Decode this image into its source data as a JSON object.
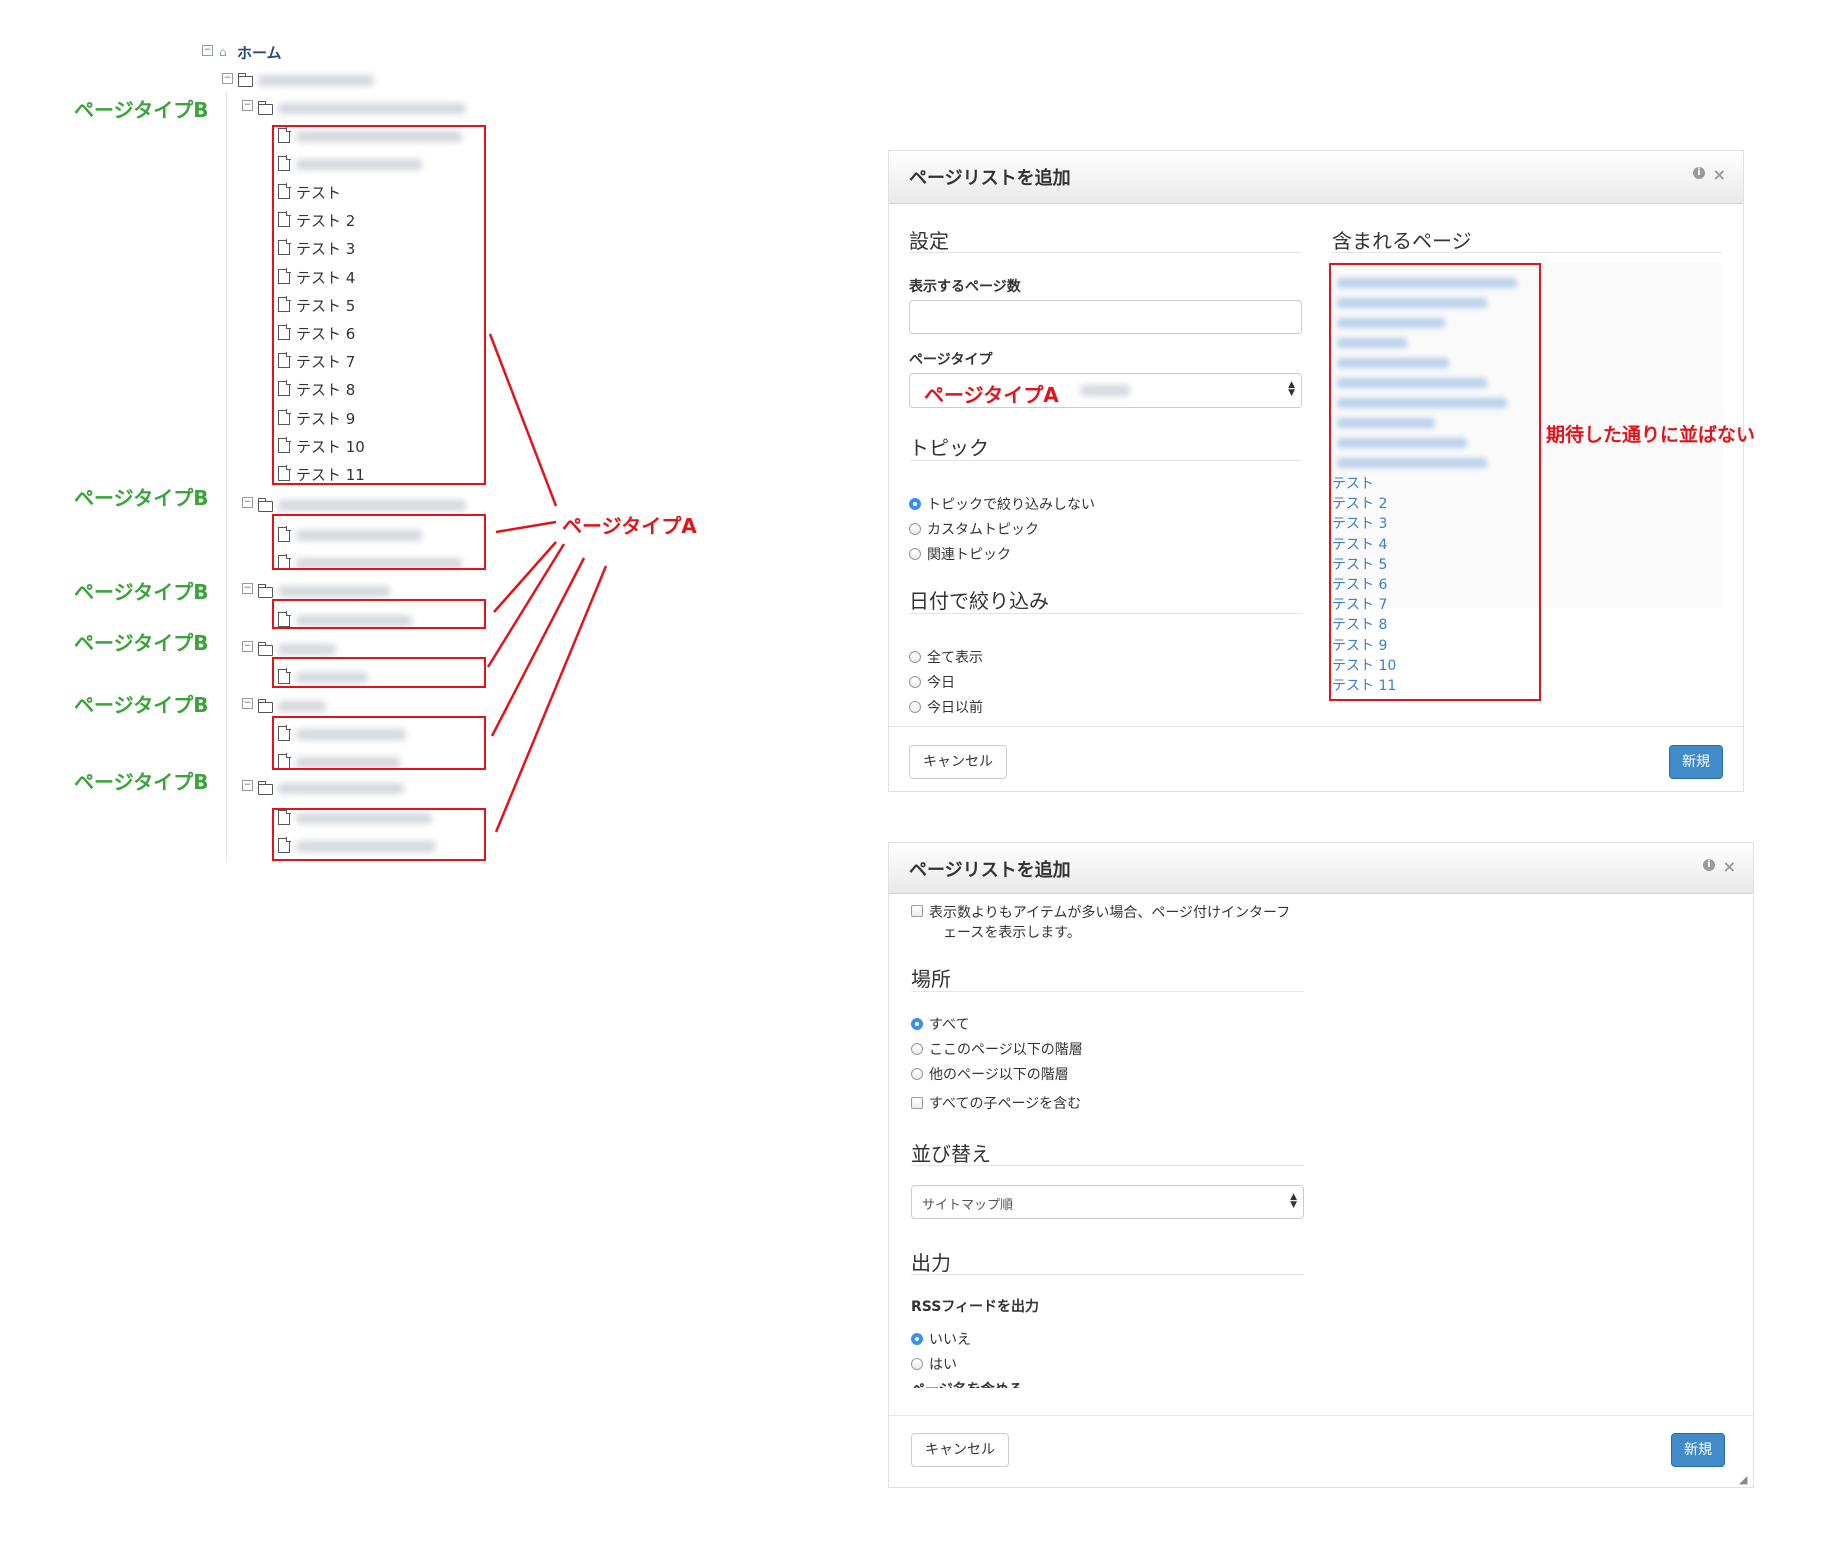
{
  "tree": {
    "home_label": "ホーム",
    "test_pages": [
      "テスト",
      "テスト 2",
      "テスト 3",
      "テスト 4",
      "テスト 5",
      "テスト 6",
      "テスト 7",
      "テスト 8",
      "テスト 9",
      "テスト 10",
      "テスト 11"
    ]
  },
  "annotations": {
    "page_type_a": "ページタイプA",
    "page_type_b": "ページタイプB",
    "not_sorted": "期待した通りに並ばない"
  },
  "dialog1": {
    "title": "ページリストを追加",
    "settings_heading": "設定",
    "count_label": "表示するページ数",
    "count_value": "",
    "page_type_label": "ページタイプ",
    "page_type_value": "ページタイプA",
    "topic_heading": "トピック",
    "topic_options": [
      "トピックで絞り込みしない",
      "カスタムトピック",
      "関連トピック"
    ],
    "date_heading": "日付で絞り込み",
    "date_options": [
      "全て表示",
      "今日",
      "今日以前"
    ],
    "included_heading": "含まれるページ",
    "included_pages": [
      "テスト",
      "テスト 2",
      "テスト 3",
      "テスト 4",
      "テスト 5",
      "テスト 6",
      "テスト 7",
      "テスト 8",
      "テスト 9",
      "テスト 10",
      "テスト 11"
    ],
    "cancel_label": "キャンセル",
    "new_label": "新規"
  },
  "dialog2": {
    "title": "ページリストを追加",
    "pagination_label_1": "表示数よりもアイテムが多い場合、ページ付けインターフ",
    "pagination_label_2": "ェースを表示します。",
    "location_heading": "場所",
    "location_options": [
      "すべて",
      "ここのページ以下の階層",
      "他のページ以下の階層"
    ],
    "include_children_label": "すべての子ページを含む",
    "sort_heading": "並び替え",
    "sort_value": "サイトマップ順",
    "output_heading": "出力",
    "rss_label": "RSSフィードを出力",
    "rss_options": [
      "いいえ",
      "はい"
    ],
    "cut_label": "ページ名を含める",
    "cancel_label": "キャンセル",
    "new_label": "新規"
  }
}
